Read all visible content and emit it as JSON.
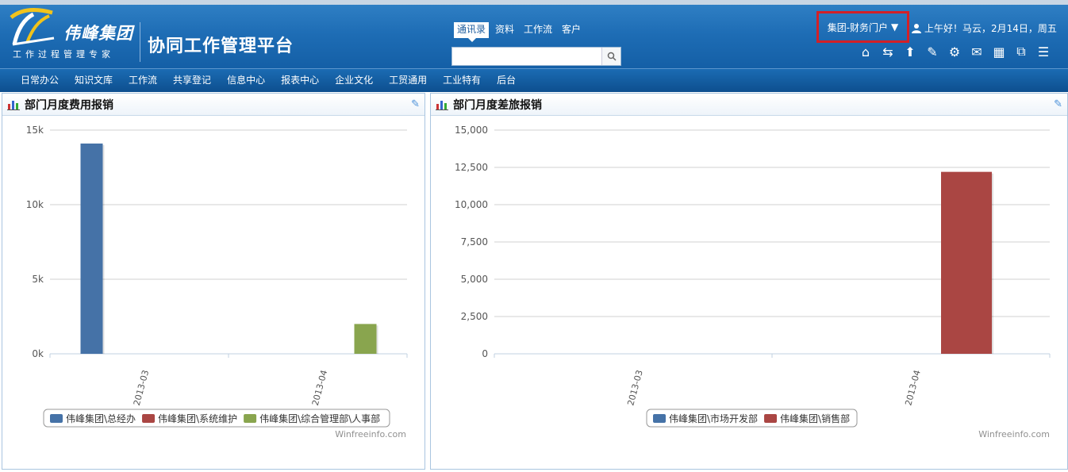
{
  "header": {
    "logo_name": "伟峰集团",
    "logo_sub": "工作过程管理专家",
    "platform_title": "协同工作管理平台",
    "search_tabs": [
      "通讯录",
      "资料",
      "工作流",
      "客户"
    ],
    "search_placeholder": "",
    "portal_label": "集团-财务门户",
    "greeting": "上午好！马云，2月14日，周五",
    "toolbar_icons": [
      "home-icon",
      "switch-icon",
      "upload-icon",
      "edit-icon",
      "settings-icon",
      "mail-icon",
      "calendar-icon",
      "binoculars-icon",
      "notebook-icon"
    ]
  },
  "nav": {
    "items": [
      "日常办公",
      "知识文库",
      "工作流",
      "共享登记",
      "信息中心",
      "报表中心",
      "企业文化",
      "工贸通用",
      "工业特有",
      "后台"
    ]
  },
  "panels": {
    "left_title": "部门月度费用报销",
    "right_title": "部门月度差旅报销",
    "credit": "Winfreeinfo.com"
  },
  "colors": {
    "header": "#1e6db5",
    "series_blue": "#4572a7",
    "series_red": "#aa4643",
    "series_green": "#89a54e",
    "highlight_border": "#d32027"
  },
  "chart_data": [
    {
      "type": "bar",
      "title": "部门月度费用报销",
      "categories": [
        "2013-03",
        "2013-04"
      ],
      "ylim": [
        0,
        15000
      ],
      "yticks": [
        "0k",
        "5k",
        "10k",
        "15k"
      ],
      "grid": true,
      "legend": "bottom",
      "series": [
        {
          "name": "伟峰集团\\总经办",
          "color": "#4572a7",
          "values": [
            14100,
            0
          ]
        },
        {
          "name": "伟峰集团\\系统维护",
          "color": "#aa4643",
          "values": [
            0,
            0
          ]
        },
        {
          "name": "伟峰集团\\综合管理部\\人事部",
          "color": "#89a54e",
          "values": [
            0,
            2000
          ]
        }
      ]
    },
    {
      "type": "bar",
      "title": "部门月度差旅报销",
      "categories": [
        "2013-03",
        "2013-04"
      ],
      "ylim": [
        0,
        15000
      ],
      "yticks": [
        "0",
        "2,500",
        "5,000",
        "7,500",
        "10,000",
        "12,500",
        "15,000"
      ],
      "grid": true,
      "legend": "bottom",
      "series": [
        {
          "name": "伟峰集团\\市场开发部",
          "color": "#4572a7",
          "values": [
            0,
            0
          ]
        },
        {
          "name": "伟峰集团\\销售部",
          "color": "#aa4643",
          "values": [
            0,
            12200
          ]
        }
      ]
    }
  ]
}
